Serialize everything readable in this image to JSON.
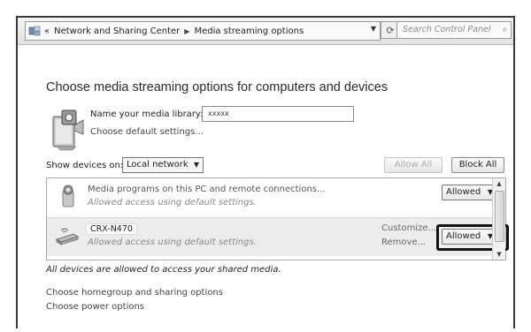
{
  "address": {
    "nav_chevrons": "«",
    "crumb1": "Network and Sharing Center",
    "crumb_sep": "▶",
    "crumb2": "Media streaming options",
    "dropdown_glyph": "▼",
    "refresh_glyph": "⟳",
    "search_placeholder": "Search Control Panel",
    "search_glyph": "⌕"
  },
  "page_title": "Choose media streaming options for computers and devices",
  "library": {
    "label": "Name your media library:",
    "value": "xxxxx",
    "default_link": "Choose default settings..."
  },
  "show_devices": {
    "label": "Show devices on:",
    "selected": "Local network",
    "arrow": "▼"
  },
  "buttons": {
    "allow_all": "Allow All",
    "block_all": "Block All"
  },
  "devices": [
    {
      "name": "Media programs on this PC and remote connections...",
      "status": "Allowed access using default settings.",
      "permission": "Allowed",
      "arrow": "▼",
      "icon": "media-player-icon"
    },
    {
      "name": "CRX-N470",
      "status": "Allowed access using default settings.",
      "permission": "Allowed",
      "arrow": "▼",
      "customize": "Customize...",
      "remove": "Remove...",
      "icon": "network-device-icon"
    }
  ],
  "scroll": {
    "up": "▲",
    "down": "▼"
  },
  "note": "All devices are allowed to access your shared media.",
  "links": {
    "homegroup": "Choose homegroup and sharing options",
    "power": "Choose power options"
  },
  "colors": {
    "highlight_border": "#111111",
    "selected_row_bg": "#ececec"
  }
}
